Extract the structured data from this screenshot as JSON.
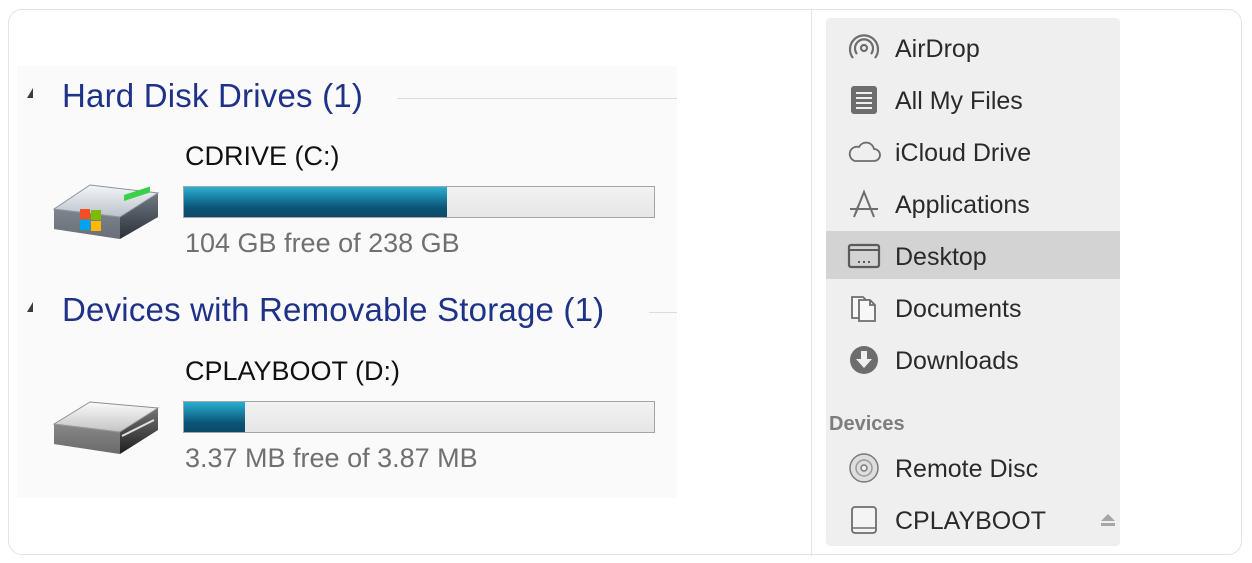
{
  "windows_explorer": {
    "groups": [
      {
        "title": "Hard Disk Drives (1)",
        "drives": [
          {
            "name": "CDRIVE (C:)",
            "usage_fraction": 0.56,
            "free_text": "104 GB free of 238 GB",
            "icon": "windows-hard-drive-icon"
          }
        ]
      },
      {
        "title": "Devices with Removable Storage (1)",
        "drives": [
          {
            "name": "CPLAYBOOT (D:)",
            "usage_fraction": 0.13,
            "free_text": "3.37 MB free of 3.87 MB",
            "icon": "removable-drive-icon"
          }
        ]
      }
    ]
  },
  "finder_sidebar": {
    "favorites": [
      {
        "label": "AirDrop",
        "icon": "airdrop-icon"
      },
      {
        "label": "All My Files",
        "icon": "all-my-files-icon"
      },
      {
        "label": "iCloud Drive",
        "icon": "cloud-icon"
      },
      {
        "label": "Applications",
        "icon": "applications-icon"
      },
      {
        "label": "Desktop",
        "icon": "desktop-icon",
        "selected": true
      },
      {
        "label": "Documents",
        "icon": "documents-icon"
      },
      {
        "label": "Downloads",
        "icon": "downloads-icon"
      }
    ],
    "devices_header": "Devices",
    "devices": [
      {
        "label": "Remote Disc",
        "icon": "remote-disc-icon"
      },
      {
        "label": "CPLAYBOOT",
        "icon": "external-drive-icon",
        "ejectable": true,
        "eject_icon": "eject-icon"
      }
    ]
  },
  "colors": {
    "group_title": "#1e3287",
    "bar_fill": "#0b5475",
    "selected_row": "#d3d3d3",
    "sidebar_bg": "#efefef"
  }
}
